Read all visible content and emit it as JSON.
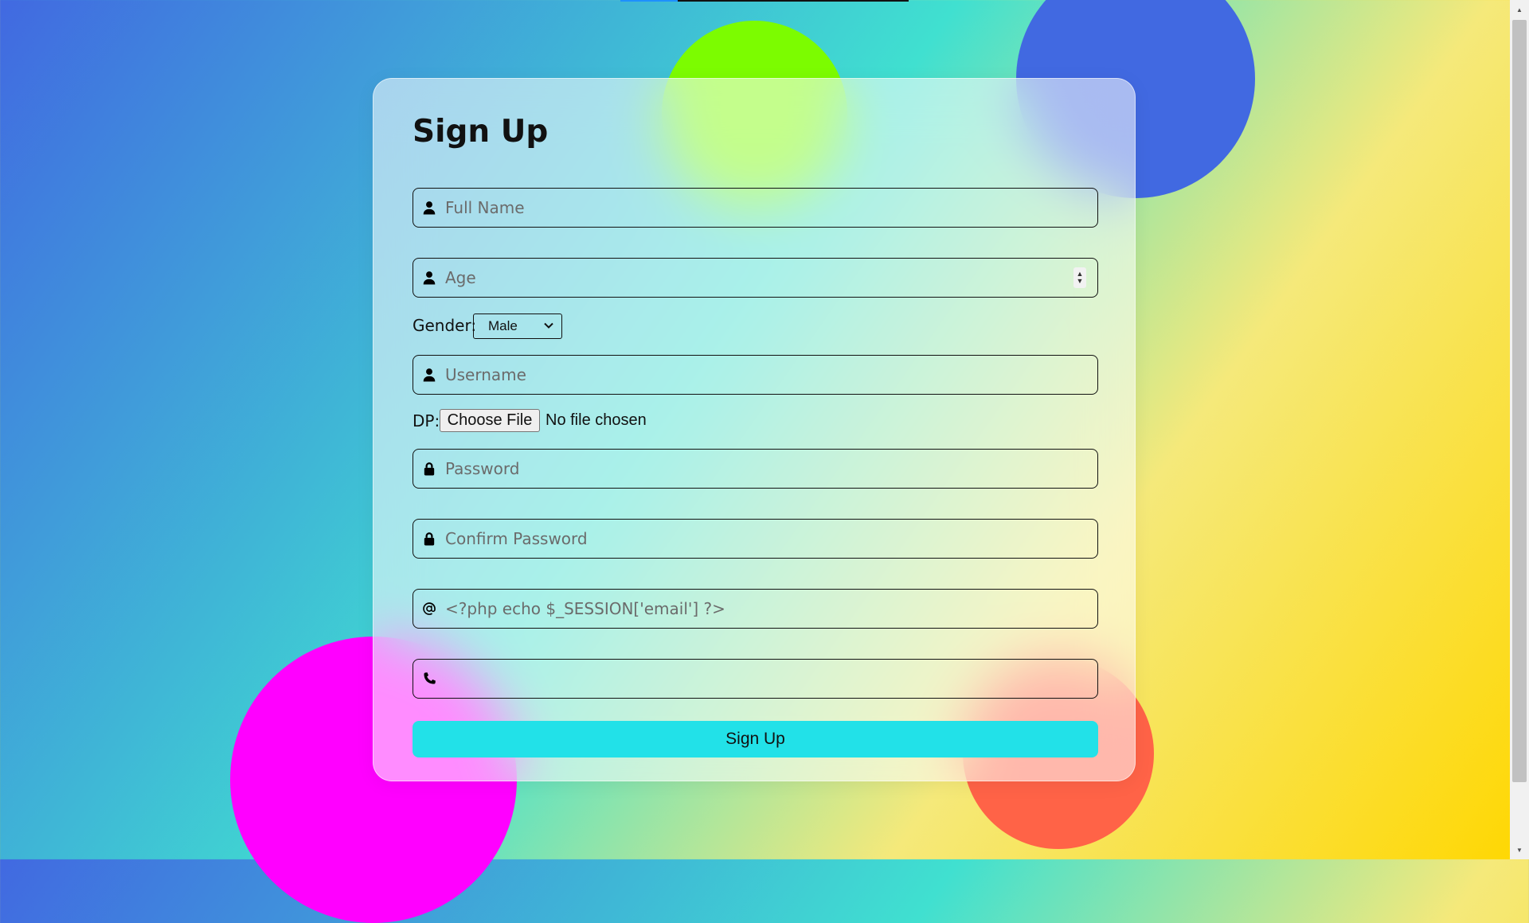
{
  "page": {
    "loading_progress": 0.2
  },
  "colors": {
    "accent_button": "#22e1e8",
    "circle_green": "#7cfc00",
    "circle_blue": "#4169e1",
    "circle_magenta": "#ff00ff",
    "circle_coral": "#ff6347"
  },
  "form": {
    "title": "Sign Up",
    "fields": {
      "full_name": {
        "placeholder": "Full Name",
        "icon": "user-icon"
      },
      "age": {
        "placeholder": "Age",
        "icon": "user-icon"
      },
      "username": {
        "placeholder": "Username",
        "icon": "user-icon"
      },
      "password": {
        "placeholder": "Password",
        "icon": "lock-icon"
      },
      "confirm_password": {
        "placeholder": "Confirm Password",
        "icon": "lock-icon"
      },
      "email": {
        "placeholder": "<?php echo $_SESSION['email'] ?>",
        "icon": "at-icon"
      },
      "phone": {
        "placeholder": "",
        "icon": "phone-icon"
      }
    },
    "gender": {
      "label": "Gender:",
      "selected": "Male"
    },
    "dp": {
      "label": "DP:",
      "button_label": "Choose File",
      "status": "No file chosen"
    },
    "submit_label": "Sign Up"
  }
}
